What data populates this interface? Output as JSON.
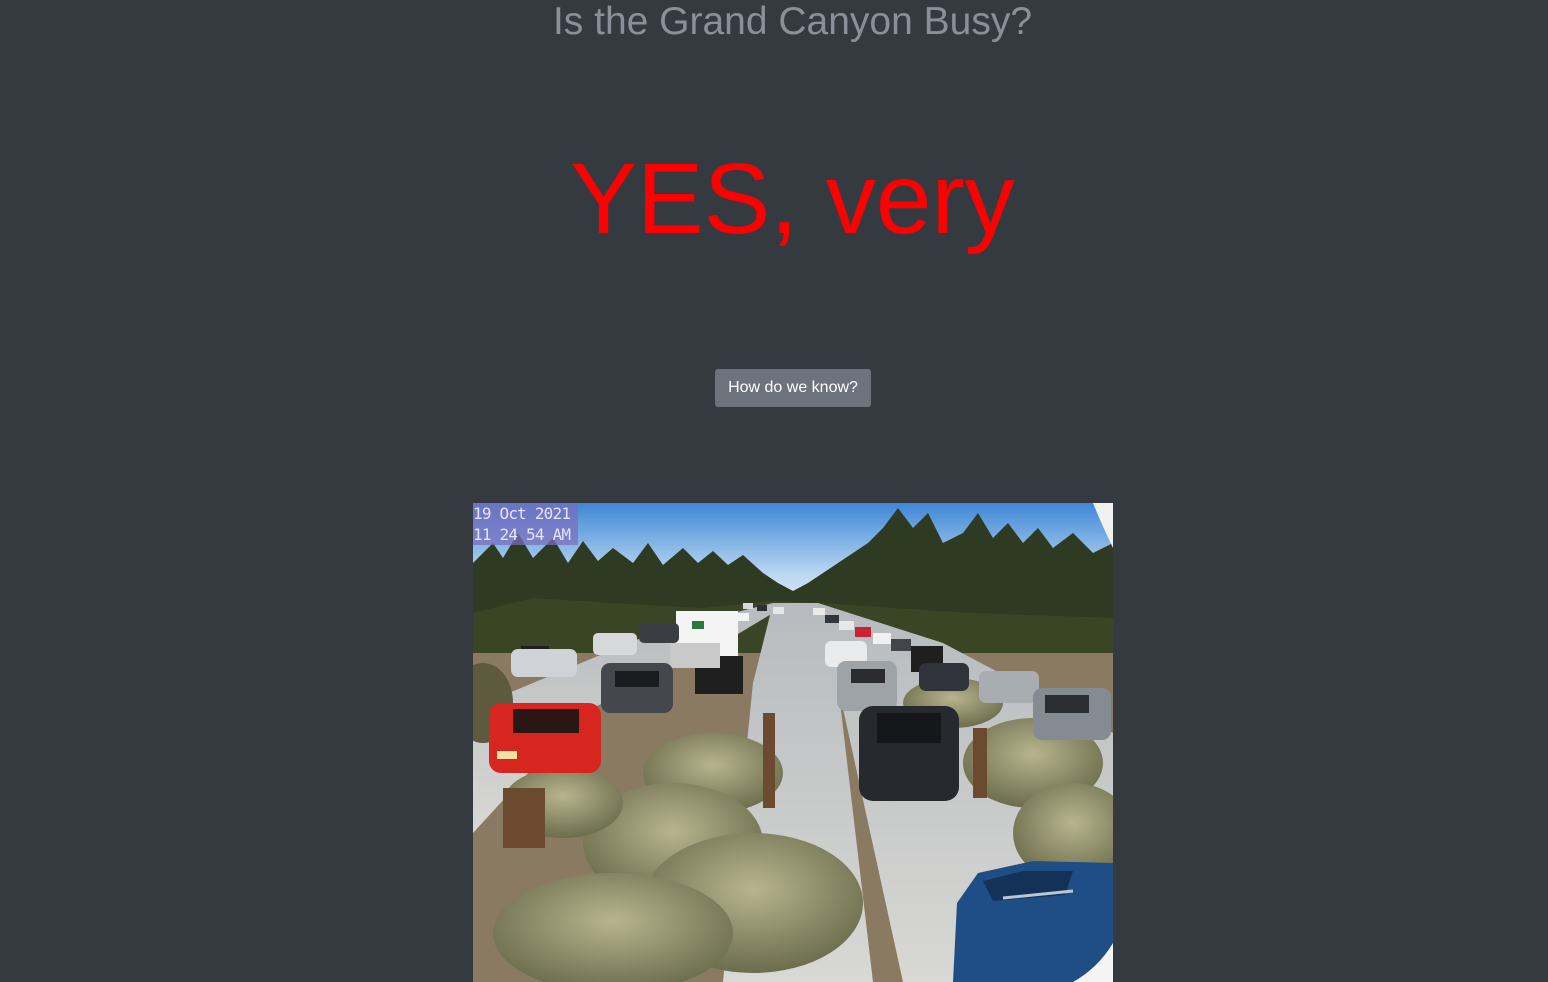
{
  "header": {
    "title": "Is the Grand Canyon Busy?"
  },
  "status": {
    "answer": "YES, very",
    "answer_color": "#ff0000"
  },
  "info_button": {
    "label": "How do we know?"
  },
  "webcam": {
    "date": "19 Oct 2021",
    "time": "11 24 54 AM"
  },
  "colors": {
    "background": "#353a41",
    "title": "#8a8f99",
    "button": "#6c737c"
  }
}
